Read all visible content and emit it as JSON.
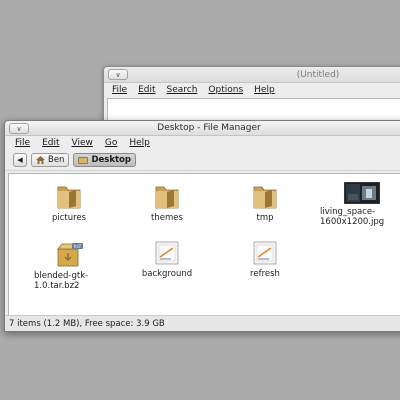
{
  "editor": {
    "title": "(Untitled)",
    "menu": [
      "File",
      "Edit",
      "Search",
      "Options",
      "Help"
    ]
  },
  "file_manager": {
    "title": "Desktop - File Manager",
    "menu": [
      "File",
      "Edit",
      "View",
      "Go",
      "Help"
    ],
    "pathbar": {
      "back_icon": "left-arrow-icon",
      "home_label": "Ben",
      "current_label": "Desktop"
    },
    "items": [
      {
        "label": "pictures",
        "type": "folder"
      },
      {
        "label": "themes",
        "type": "folder"
      },
      {
        "label": "tmp",
        "type": "folder"
      },
      {
        "label": "living_space-1600x1200.jpg",
        "type": "image"
      },
      {
        "label": "blended-gtk-1.0.tar.bz2",
        "type": "archive"
      },
      {
        "label": "background",
        "type": "file"
      },
      {
        "label": "refresh",
        "type": "file"
      }
    ],
    "status": "7 items (1.2 MB), Free space: 3.9 GB"
  },
  "colors": {
    "desktop": "#ababab",
    "window": "#ededed",
    "folder": "#d8b46a",
    "folder_dark": "#b38a3c"
  }
}
